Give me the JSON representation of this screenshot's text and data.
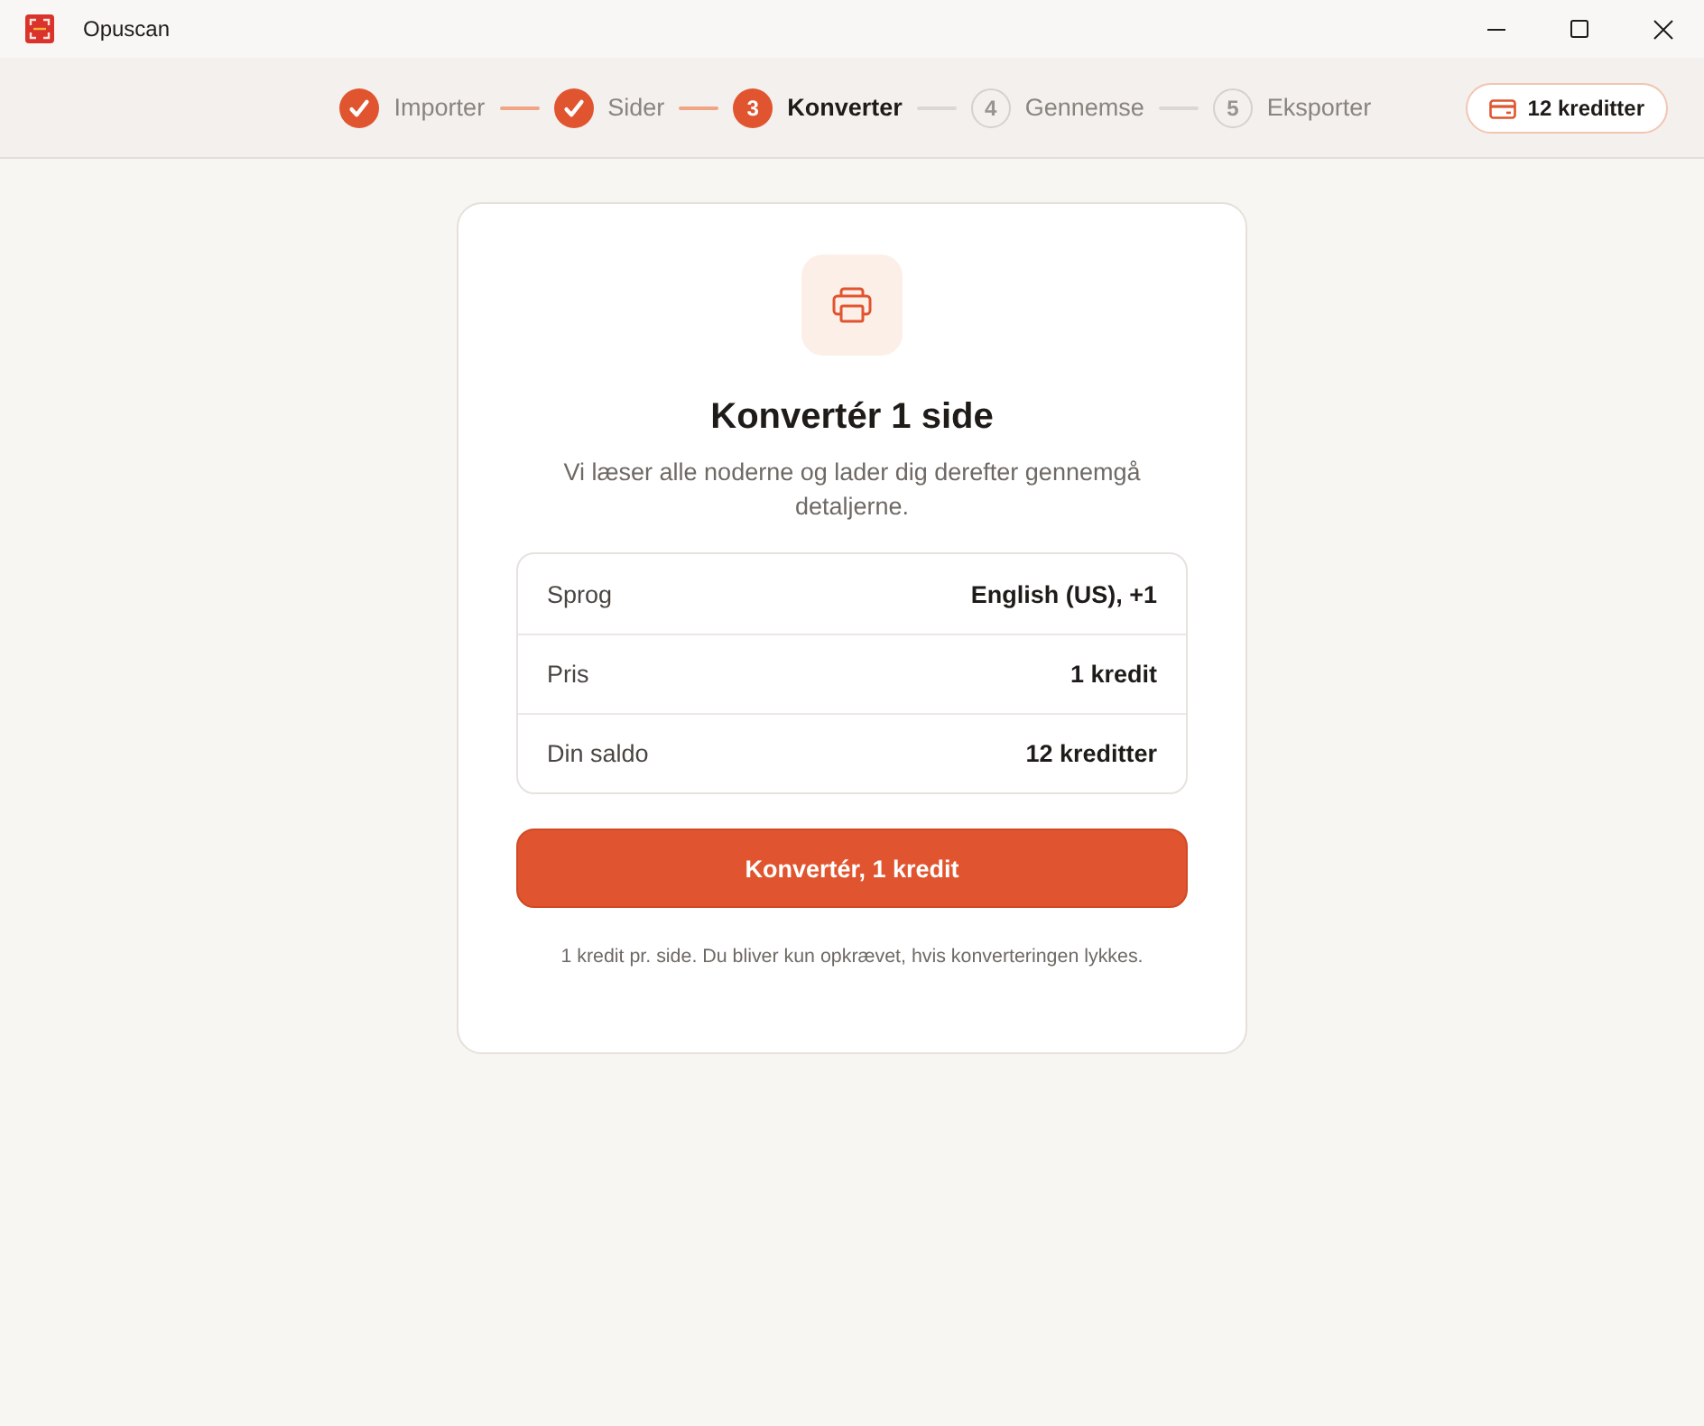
{
  "window": {
    "title": "Opuscan"
  },
  "steps": [
    {
      "label": "Importer",
      "done": true,
      "active": false
    },
    {
      "label": "Sider",
      "done": true,
      "active": false
    },
    {
      "label": "Konverter",
      "done": false,
      "active": true,
      "number": "3"
    },
    {
      "label": "Gennemse",
      "done": false,
      "active": false,
      "number": "4"
    },
    {
      "label": "Eksporter",
      "done": false,
      "active": false,
      "number": "5"
    }
  ],
  "credits_button": {
    "label": "12 kreditter"
  },
  "card": {
    "title": "Konvertér 1 side",
    "description": "Vi læser alle noderne og lader dig derefter gennemgå detaljerne.",
    "details": [
      {
        "label": "Sprog",
        "value": "English (US), +1"
      },
      {
        "label": "Pris",
        "value": "1 kredit"
      },
      {
        "label": "Din saldo",
        "value": "12 kreditter"
      }
    ],
    "primary_button": {
      "label": "Konvertér, 1 kredit"
    },
    "footnote": "1 kredit pr. side. Du bliver kun opkrævet, hvis konverteringen lykkes."
  }
}
